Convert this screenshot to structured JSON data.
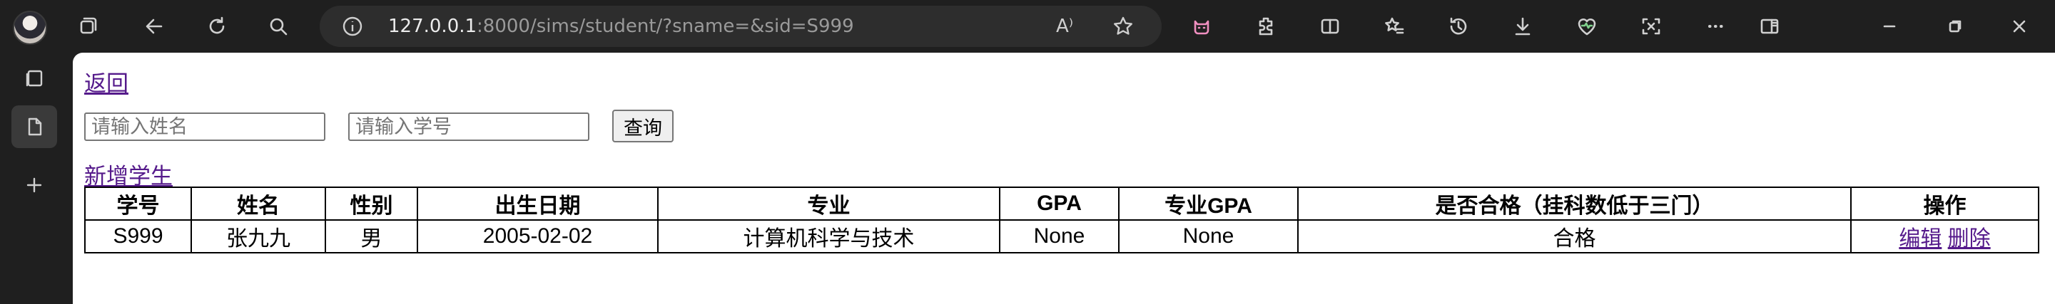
{
  "browser": {
    "url_host": "127.0.0.1",
    "url_rest": ":8000/sims/student/?sname=&sid=S999",
    "read_aloud_glyph": "A⁾"
  },
  "page": {
    "back_link": "返回",
    "search": {
      "name_placeholder": "请输入姓名",
      "sid_placeholder": "请输入学号",
      "name_value": "",
      "sid_value": "",
      "query_button": "查询"
    },
    "add_link": "新增学生",
    "table": {
      "headers": {
        "sid": "学号",
        "name": "姓名",
        "gender": "性别",
        "birth": "出生日期",
        "major": "专业",
        "gpa": "GPA",
        "major_gpa": "专业GPA",
        "qualified": "是否合格（挂科数低于三门）",
        "actions": "操作"
      },
      "rows": [
        {
          "sid": "S999",
          "name": "张九九",
          "gender": "男",
          "birth": "2005-02-02",
          "major": "计算机科学与技术",
          "gpa": "None",
          "major_gpa": "None",
          "qualified": "合格",
          "edit": "编辑",
          "delete": "删除"
        }
      ]
    }
  }
}
